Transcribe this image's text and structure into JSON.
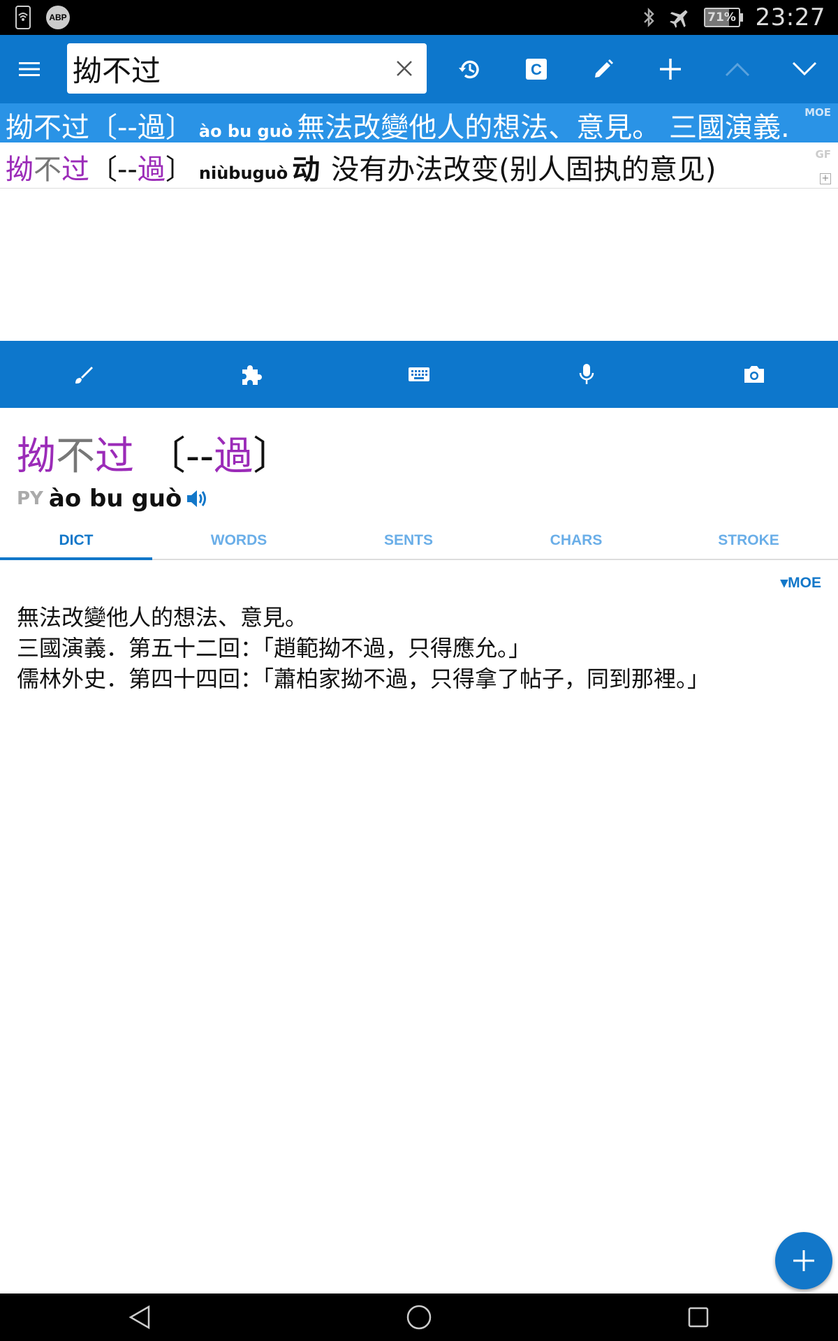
{
  "status_bar": {
    "time": "23:27",
    "battery_percent": "71%",
    "battery_level": 0.71,
    "adblock_label": "ABP",
    "icons": [
      "wifi-phone-icon",
      "adblock-icon",
      "bluetooth-icon",
      "airplane-icon",
      "battery-icon"
    ]
  },
  "toolbar": {
    "search_value": "拗不过",
    "icons": [
      "menu-icon",
      "clear-icon",
      "history-icon",
      "clipboard-icon",
      "edit-icon",
      "add-icon",
      "prev-icon",
      "next-icon"
    ],
    "accent": "#0d77cc"
  },
  "results": [
    {
      "simp_1": "拗不过",
      "trad_open": "〔--",
      "trad_char": "過",
      "trad_close": "〕",
      "pinyin": "ào bu guò",
      "definition": "無法改變他人的想法、意見。 三國演義.",
      "source": "MOE",
      "selected": true
    },
    {
      "simp_1": "拗",
      "simp_2": "不",
      "simp_3": "过",
      "trad_open": "〔--",
      "trad_char": "過",
      "trad_close": "〕",
      "pinyin": "niùbuguò",
      "pos": "动",
      "definition": "没有办法改变(别人固执的意见)",
      "source": "GF",
      "expand": "+"
    }
  ],
  "input_methods": [
    "handwriting-icon",
    "plugin-icon",
    "keyboard-icon",
    "microphone-icon",
    "camera-icon"
  ],
  "entry": {
    "simp_1": "拗",
    "simp_2": "不",
    "simp_3": "过",
    "trad_open": "〔--",
    "trad_char": "過",
    "trad_close": "〕",
    "pinyin_label": "PY",
    "pinyin": "ào bu guò"
  },
  "tabs": [
    {
      "label": "DICT",
      "active": true
    },
    {
      "label": "WORDS"
    },
    {
      "label": "SENTS"
    },
    {
      "label": "CHARS"
    },
    {
      "label": "STROKE"
    }
  ],
  "definition_block": {
    "source_toggle": "▾MOE",
    "lines": [
      "無法改變他人的想法、意見。",
      "三國演義．第五十二回：「趙範拗不過，只得應允。」",
      "儒林外史．第四十四回：「蕭柏家拗不過，只得拿了帖子，同到那裡。」"
    ]
  },
  "colors": {
    "primary": "#0d77cc",
    "selected_row": "#2a93e6",
    "tone_purple": "#9b2bb8",
    "neutral_grey": "#777777",
    "tab_active": "#1277c9",
    "tab_inactive": "#6aaee8"
  },
  "fab_icon": "add-icon",
  "nav_bar": [
    "back-icon",
    "home-icon",
    "recents-icon"
  ]
}
